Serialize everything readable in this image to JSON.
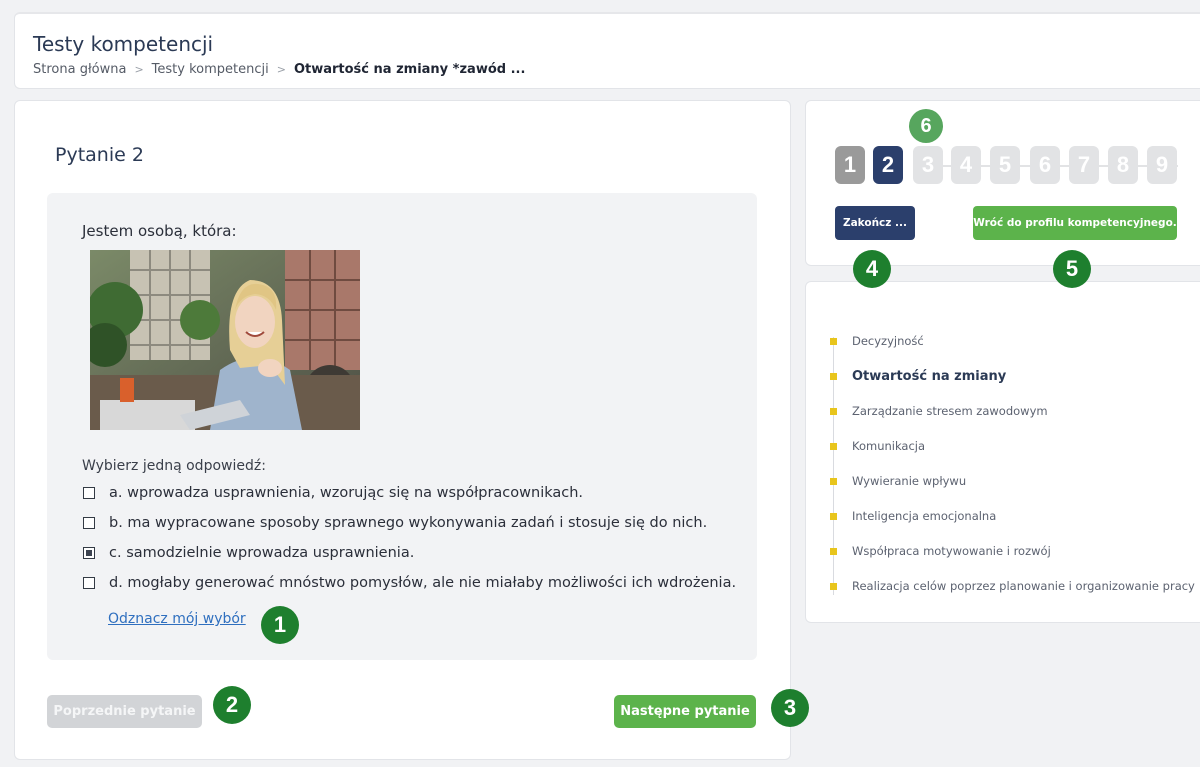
{
  "header": {
    "title": "Testy kompetencji",
    "breadcrumb": [
      "Strona główna",
      "Testy kompetencji",
      "Otwartość na zmiany *zawód ..."
    ],
    "separator": ">"
  },
  "question": {
    "title": "Pytanie 2",
    "stem": "Jestem osobą, która:",
    "choose_label": "Wybierz jedną odpowiedź:",
    "options": [
      {
        "text": "a. wprowadza usprawnienia, wzorując się na współpracownikach.",
        "checked": false
      },
      {
        "text": "b. ma wypracowane sposoby sprawnego wykonywania zadań i stosuje się do nich.",
        "checked": false
      },
      {
        "text": "c. samodzielnie wprowadza usprawnienia.",
        "checked": true
      },
      {
        "text": "d. mogłaby generować mnóstwo pomysłów, ale nie miałaby możliwości ich wdrożenia.",
        "checked": false
      }
    ],
    "clear_link": "Odznacz mój wybór"
  },
  "buttons": {
    "prev": "Poprzednie pytanie",
    "next": "Następne pytanie",
    "finish": "Zakończ ...",
    "back_profile": "Wróć do profilu kompetencyjnego."
  },
  "navigation": {
    "question_numbers": [
      "1",
      "2",
      "3",
      "4",
      "5",
      "6",
      "7",
      "8",
      "9"
    ],
    "current": 2
  },
  "badges": [
    "1",
    "2",
    "3",
    "4",
    "5",
    "6"
  ],
  "competencies": {
    "items": [
      "Decyzyjność",
      "Otwartość na zmiany",
      "Zarządzanie stresem zawodowym",
      "Komunikacja",
      "Wywieranie wpływu",
      "Inteligencja emocjonalna",
      "Współpraca motywowanie i rozwój",
      "Realizacja celów poprzez planowanie i organizowanie pracy"
    ],
    "active_index": 1
  },
  "colors": {
    "primary_navy": "#2b3f6c",
    "green": "#5cb34b",
    "badge_green": "#1e7f2e",
    "bullet_yellow": "#e8c51c"
  },
  "image": {
    "subject": "photo-smiling-woman-with-laptop"
  }
}
